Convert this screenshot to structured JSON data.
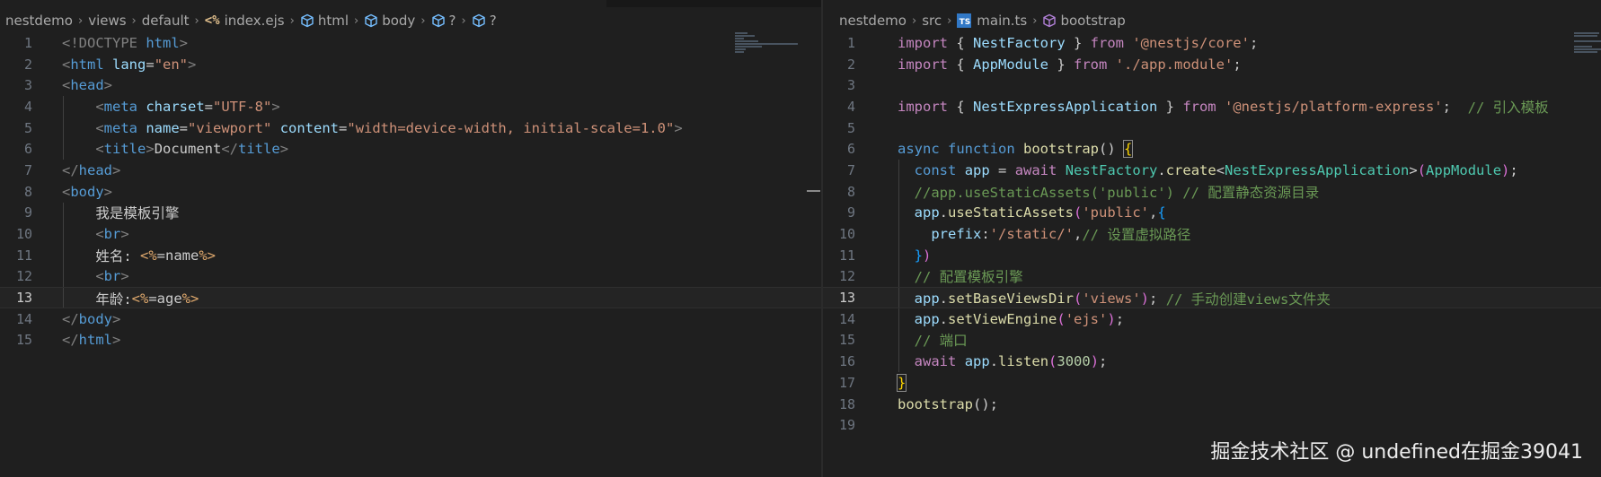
{
  "left_editor": {
    "breadcrumbs": [
      "nestdemo",
      "views",
      "default",
      "index.ejs",
      "html",
      "body",
      "?",
      "?"
    ],
    "file_icon_text": "<%",
    "active_line": 13,
    "lines": [
      {
        "n": "1",
        "tokens": [
          {
            "t": "<!DOCTYPE ",
            "c": "p"
          },
          {
            "t": "html",
            "c": "tag"
          },
          {
            "t": ">",
            "c": "p"
          }
        ]
      },
      {
        "n": "2",
        "tokens": [
          {
            "t": "<",
            "c": "p"
          },
          {
            "t": "html",
            "c": "tag"
          },
          {
            "t": " ",
            "c": ""
          },
          {
            "t": "lang",
            "c": "attr"
          },
          {
            "t": "=",
            "c": ""
          },
          {
            "t": "\"en\"",
            "c": "str"
          },
          {
            "t": ">",
            "c": "p"
          }
        ]
      },
      {
        "n": "3",
        "tokens": [
          {
            "t": "<",
            "c": "p"
          },
          {
            "t": "head",
            "c": "tag"
          },
          {
            "t": ">",
            "c": "p"
          }
        ]
      },
      {
        "n": "4",
        "tokens": [
          {
            "t": "    <",
            "c": "p"
          },
          {
            "t": "meta",
            "c": "tag"
          },
          {
            "t": " ",
            "c": ""
          },
          {
            "t": "charset",
            "c": "attr"
          },
          {
            "t": "=",
            "c": ""
          },
          {
            "t": "\"UTF-8\"",
            "c": "str"
          },
          {
            "t": ">",
            "c": "p"
          }
        ]
      },
      {
        "n": "5",
        "tokens": [
          {
            "t": "    <",
            "c": "p"
          },
          {
            "t": "meta",
            "c": "tag"
          },
          {
            "t": " ",
            "c": ""
          },
          {
            "t": "name",
            "c": "attr"
          },
          {
            "t": "=",
            "c": ""
          },
          {
            "t": "\"viewport\"",
            "c": "str"
          },
          {
            "t": " ",
            "c": ""
          },
          {
            "t": "content",
            "c": "attr"
          },
          {
            "t": "=",
            "c": ""
          },
          {
            "t": "\"width=device-width, initial-scale=1.0\"",
            "c": "str"
          },
          {
            "t": ">",
            "c": "p"
          }
        ]
      },
      {
        "n": "6",
        "tokens": [
          {
            "t": "    <",
            "c": "p"
          },
          {
            "t": "title",
            "c": "tag"
          },
          {
            "t": ">",
            "c": "p"
          },
          {
            "t": "Document",
            "c": ""
          },
          {
            "t": "</",
            "c": "p"
          },
          {
            "t": "title",
            "c": "tag"
          },
          {
            "t": ">",
            "c": "p"
          }
        ]
      },
      {
        "n": "7",
        "tokens": [
          {
            "t": "</",
            "c": "p"
          },
          {
            "t": "head",
            "c": "tag"
          },
          {
            "t": ">",
            "c": "p"
          }
        ]
      },
      {
        "n": "8",
        "tokens": [
          {
            "t": "<",
            "c": "p"
          },
          {
            "t": "body",
            "c": "tag"
          },
          {
            "t": ">",
            "c": "p"
          }
        ]
      },
      {
        "n": "9",
        "tokens": [
          {
            "t": "    我是模板引擎",
            "c": ""
          }
        ]
      },
      {
        "n": "10",
        "tokens": [
          {
            "t": "    <",
            "c": "p"
          },
          {
            "t": "br",
            "c": "tag"
          },
          {
            "t": ">",
            "c": "p"
          }
        ]
      },
      {
        "n": "11",
        "tokens": [
          {
            "t": "    姓名: ",
            "c": ""
          },
          {
            "t": "<%",
            "c": "ejs"
          },
          {
            "t": "=name",
            "c": ""
          },
          {
            "t": "%>",
            "c": "ejs"
          }
        ]
      },
      {
        "n": "12",
        "tokens": [
          {
            "t": "    <",
            "c": "p"
          },
          {
            "t": "br",
            "c": "tag"
          },
          {
            "t": ">",
            "c": "p"
          }
        ]
      },
      {
        "n": "13",
        "tokens": [
          {
            "t": "    年龄:",
            "c": ""
          },
          {
            "t": "<%",
            "c": "ejs"
          },
          {
            "t": "=age",
            "c": ""
          },
          {
            "t": "%>",
            "c": "ejs"
          }
        ]
      },
      {
        "n": "14",
        "tokens": [
          {
            "t": "</",
            "c": "p"
          },
          {
            "t": "body",
            "c": "tag"
          },
          {
            "t": ">",
            "c": "p"
          }
        ]
      },
      {
        "n": "15",
        "tokens": [
          {
            "t": "</",
            "c": "p"
          },
          {
            "t": "html",
            "c": "tag"
          },
          {
            "t": ">",
            "c": "p"
          }
        ]
      }
    ]
  },
  "right_editor": {
    "breadcrumbs": [
      "nestdemo",
      "src",
      "main.ts",
      "bootstrap"
    ],
    "file_icon_text": "TS",
    "active_line": 13,
    "lines": [
      {
        "n": "1",
        "tokens": [
          {
            "t": "import",
            "c": "kw"
          },
          {
            "t": " { ",
            "c": ""
          },
          {
            "t": "NestFactory",
            "c": "var"
          },
          {
            "t": " } ",
            "c": ""
          },
          {
            "t": "from",
            "c": "kw"
          },
          {
            "t": " ",
            "c": ""
          },
          {
            "t": "'@nestjs/core'",
            "c": "str"
          },
          {
            "t": ";",
            "c": ""
          }
        ]
      },
      {
        "n": "2",
        "tokens": [
          {
            "t": "import",
            "c": "kw"
          },
          {
            "t": " { ",
            "c": ""
          },
          {
            "t": "AppModule",
            "c": "var"
          },
          {
            "t": " } ",
            "c": ""
          },
          {
            "t": "from",
            "c": "kw"
          },
          {
            "t": " ",
            "c": ""
          },
          {
            "t": "'./app.module'",
            "c": "str"
          },
          {
            "t": ";",
            "c": ""
          }
        ]
      },
      {
        "n": "3",
        "tokens": []
      },
      {
        "n": "4",
        "tokens": [
          {
            "t": "import",
            "c": "kw"
          },
          {
            "t": " { ",
            "c": ""
          },
          {
            "t": "NestExpressApplication",
            "c": "var"
          },
          {
            "t": " } ",
            "c": ""
          },
          {
            "t": "from",
            "c": "kw"
          },
          {
            "t": " ",
            "c": ""
          },
          {
            "t": "'@nestjs/platform-express'",
            "c": "str"
          },
          {
            "t": ";  ",
            "c": ""
          },
          {
            "t": "// 引入模板",
            "c": "cm"
          }
        ]
      },
      {
        "n": "5",
        "tokens": []
      },
      {
        "n": "6",
        "tokens": [
          {
            "t": "async",
            "c": "decl"
          },
          {
            "t": " ",
            "c": ""
          },
          {
            "t": "function",
            "c": "decl"
          },
          {
            "t": " ",
            "c": ""
          },
          {
            "t": "bootstrap",
            "c": "fn"
          },
          {
            "t": "() ",
            "c": ""
          },
          {
            "t": "{",
            "c": "brc"
          }
        ]
      },
      {
        "n": "7",
        "tokens": [
          {
            "t": "  ",
            "c": ""
          },
          {
            "t": "const",
            "c": "decl"
          },
          {
            "t": " ",
            "c": ""
          },
          {
            "t": "app",
            "c": "var"
          },
          {
            "t": " = ",
            "c": ""
          },
          {
            "t": "await",
            "c": "kw"
          },
          {
            "t": " ",
            "c": ""
          },
          {
            "t": "NestFactory",
            "c": "cls"
          },
          {
            "t": ".",
            "c": ""
          },
          {
            "t": "create",
            "c": "fn"
          },
          {
            "t": "<",
            "c": ""
          },
          {
            "t": "NestExpressApplication",
            "c": "cls"
          },
          {
            "t": ">",
            "c": ""
          },
          {
            "t": "(",
            "c": "b2"
          },
          {
            "t": "AppModule",
            "c": "cls"
          },
          {
            "t": ")",
            "c": "b2"
          },
          {
            "t": ";",
            "c": ""
          }
        ]
      },
      {
        "n": "8",
        "tokens": [
          {
            "t": "  ",
            "c": ""
          },
          {
            "t": "//app.useStaticAssets('public') // 配置静态资源目录",
            "c": "cm"
          }
        ]
      },
      {
        "n": "9",
        "tokens": [
          {
            "t": "  ",
            "c": ""
          },
          {
            "t": "app",
            "c": "var"
          },
          {
            "t": ".",
            "c": ""
          },
          {
            "t": "useStaticAssets",
            "c": "fn"
          },
          {
            "t": "(",
            "c": "b2"
          },
          {
            "t": "'public'",
            "c": "str"
          },
          {
            "t": ",",
            "c": ""
          },
          {
            "t": "{",
            "c": "b3"
          }
        ]
      },
      {
        "n": "10",
        "tokens": [
          {
            "t": "    ",
            "c": ""
          },
          {
            "t": "prefix",
            "c": "var"
          },
          {
            "t": ":",
            "c": ""
          },
          {
            "t": "'/static/'",
            "c": "str"
          },
          {
            "t": ",",
            "c": ""
          },
          {
            "t": "// 设置虚拟路径",
            "c": "cm"
          }
        ]
      },
      {
        "n": "11",
        "tokens": [
          {
            "t": "  ",
            "c": ""
          },
          {
            "t": "}",
            "c": "b3"
          },
          {
            "t": ")",
            "c": "b2"
          }
        ]
      },
      {
        "n": "12",
        "tokens": [
          {
            "t": "  ",
            "c": ""
          },
          {
            "t": "// 配置模板引擎",
            "c": "cm"
          }
        ]
      },
      {
        "n": "13",
        "tokens": [
          {
            "t": "  ",
            "c": ""
          },
          {
            "t": "app",
            "c": "var"
          },
          {
            "t": ".",
            "c": ""
          },
          {
            "t": "setBaseViewsDir",
            "c": "fn"
          },
          {
            "t": "(",
            "c": "b2"
          },
          {
            "t": "'views'",
            "c": "str"
          },
          {
            "t": ")",
            "c": "b2"
          },
          {
            "t": "; ",
            "c": ""
          },
          {
            "t": "// 手动创建views文件夹",
            "c": "cm"
          }
        ]
      },
      {
        "n": "14",
        "tokens": [
          {
            "t": "  ",
            "c": ""
          },
          {
            "t": "app",
            "c": "var"
          },
          {
            "t": ".",
            "c": ""
          },
          {
            "t": "setViewEngine",
            "c": "fn"
          },
          {
            "t": "(",
            "c": "b2"
          },
          {
            "t": "'ejs'",
            "c": "str"
          },
          {
            "t": ")",
            "c": "b2"
          },
          {
            "t": ";",
            "c": ""
          }
        ]
      },
      {
        "n": "15",
        "tokens": [
          {
            "t": "  ",
            "c": ""
          },
          {
            "t": "// 端口",
            "c": "cm"
          }
        ]
      },
      {
        "n": "16",
        "tokens": [
          {
            "t": "  ",
            "c": ""
          },
          {
            "t": "await",
            "c": "kw"
          },
          {
            "t": " ",
            "c": ""
          },
          {
            "t": "app",
            "c": "var"
          },
          {
            "t": ".",
            "c": ""
          },
          {
            "t": "listen",
            "c": "fn"
          },
          {
            "t": "(",
            "c": "b2"
          },
          {
            "t": "3000",
            "c": "num"
          },
          {
            "t": ")",
            "c": "b2"
          },
          {
            "t": ";",
            "c": ""
          }
        ]
      },
      {
        "n": "17",
        "tokens": [
          {
            "t": "}",
            "c": "brc"
          }
        ]
      },
      {
        "n": "18",
        "tokens": [
          {
            "t": "bootstrap",
            "c": "fn"
          },
          {
            "t": "();",
            "c": ""
          }
        ]
      },
      {
        "n": "19",
        "tokens": []
      }
    ]
  },
  "watermark": "掘金技术社区 @ undefined在掘金39041",
  "colors": {
    "background": "#1f1f1f",
    "breadcrumb_text": "#a9a9a9",
    "line_number": "#6e7681",
    "keyword": "#c586c0",
    "string": "#ce9178",
    "comment": "#6a9955",
    "tag": "#569cd6",
    "function": "#dcdcaa",
    "variable": "#9cdcfe",
    "class": "#4ec9b0"
  }
}
